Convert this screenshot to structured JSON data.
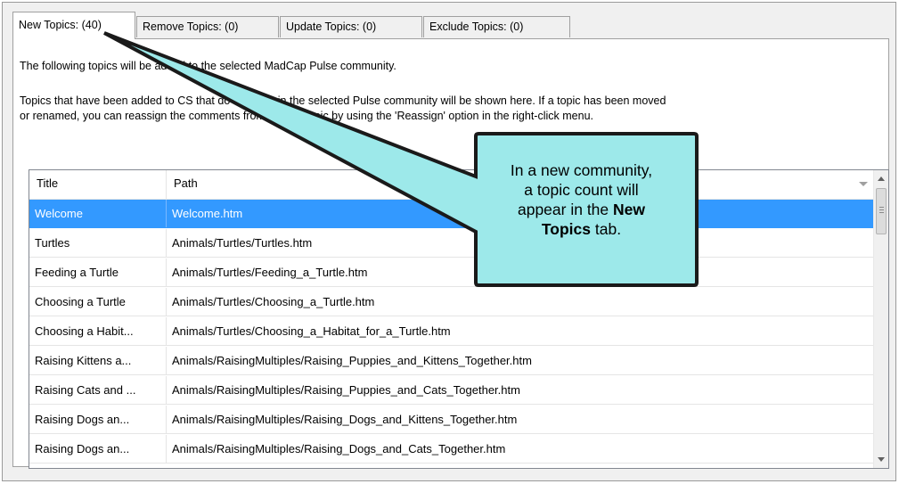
{
  "tabs": [
    {
      "label": "New Topics: (40)",
      "active": true
    },
    {
      "label": "Remove Topics: (0)",
      "active": false
    },
    {
      "label": "Update Topics: (0)",
      "active": false
    },
    {
      "label": "Exclude Topics: (0)",
      "active": false
    }
  ],
  "intro": {
    "line1": "The following topics will be added to the selected MadCap Pulse community.",
    "line2": "Topics that have been added to CS that do not exist in the selected Pulse community will be shown here. If a topic has been moved",
    "line3": "or renamed, you can reassign the comments from the old topic by using the 'Reassign' option in the right-click menu."
  },
  "table": {
    "columns": [
      "Title",
      "Path"
    ],
    "rows": [
      {
        "title": "Welcome",
        "path": "Welcome.htm",
        "selected": true
      },
      {
        "title": "Turtles",
        "path": "Animals/Turtles/Turtles.htm"
      },
      {
        "title": "Feeding a Turtle",
        "path": "Animals/Turtles/Feeding_a_Turtle.htm"
      },
      {
        "title": "Choosing a Turtle",
        "path": "Animals/Turtles/Choosing_a_Turtle.htm"
      },
      {
        "title": "Choosing a Habit...",
        "path": "Animals/Turtles/Choosing_a_Habitat_for_a_Turtle.htm"
      },
      {
        "title": "Raising Kittens a...",
        "path": "Animals/RaisingMultiples/Raising_Puppies_and_Kittens_Together.htm"
      },
      {
        "title": "Raising Cats and ...",
        "path": "Animals/RaisingMultiples/Raising_Puppies_and_Cats_Together.htm"
      },
      {
        "title": "Raising Dogs an...",
        "path": "Animals/RaisingMultiples/Raising_Dogs_and_Kittens_Together.htm"
      },
      {
        "title": "Raising Dogs an...",
        "path": "Animals/RaisingMultiples/Raising_Dogs_and_Cats_Together.htm"
      }
    ]
  },
  "callout": {
    "line1": "In a new community,",
    "line2": "a topic count will",
    "line3_pre": "appear in the ",
    "line3_bold": "New",
    "line4_bold": "Topics",
    "line4_post": " tab.",
    "fill_color": "#9de9ea",
    "border_color": "#1a1a1a"
  }
}
